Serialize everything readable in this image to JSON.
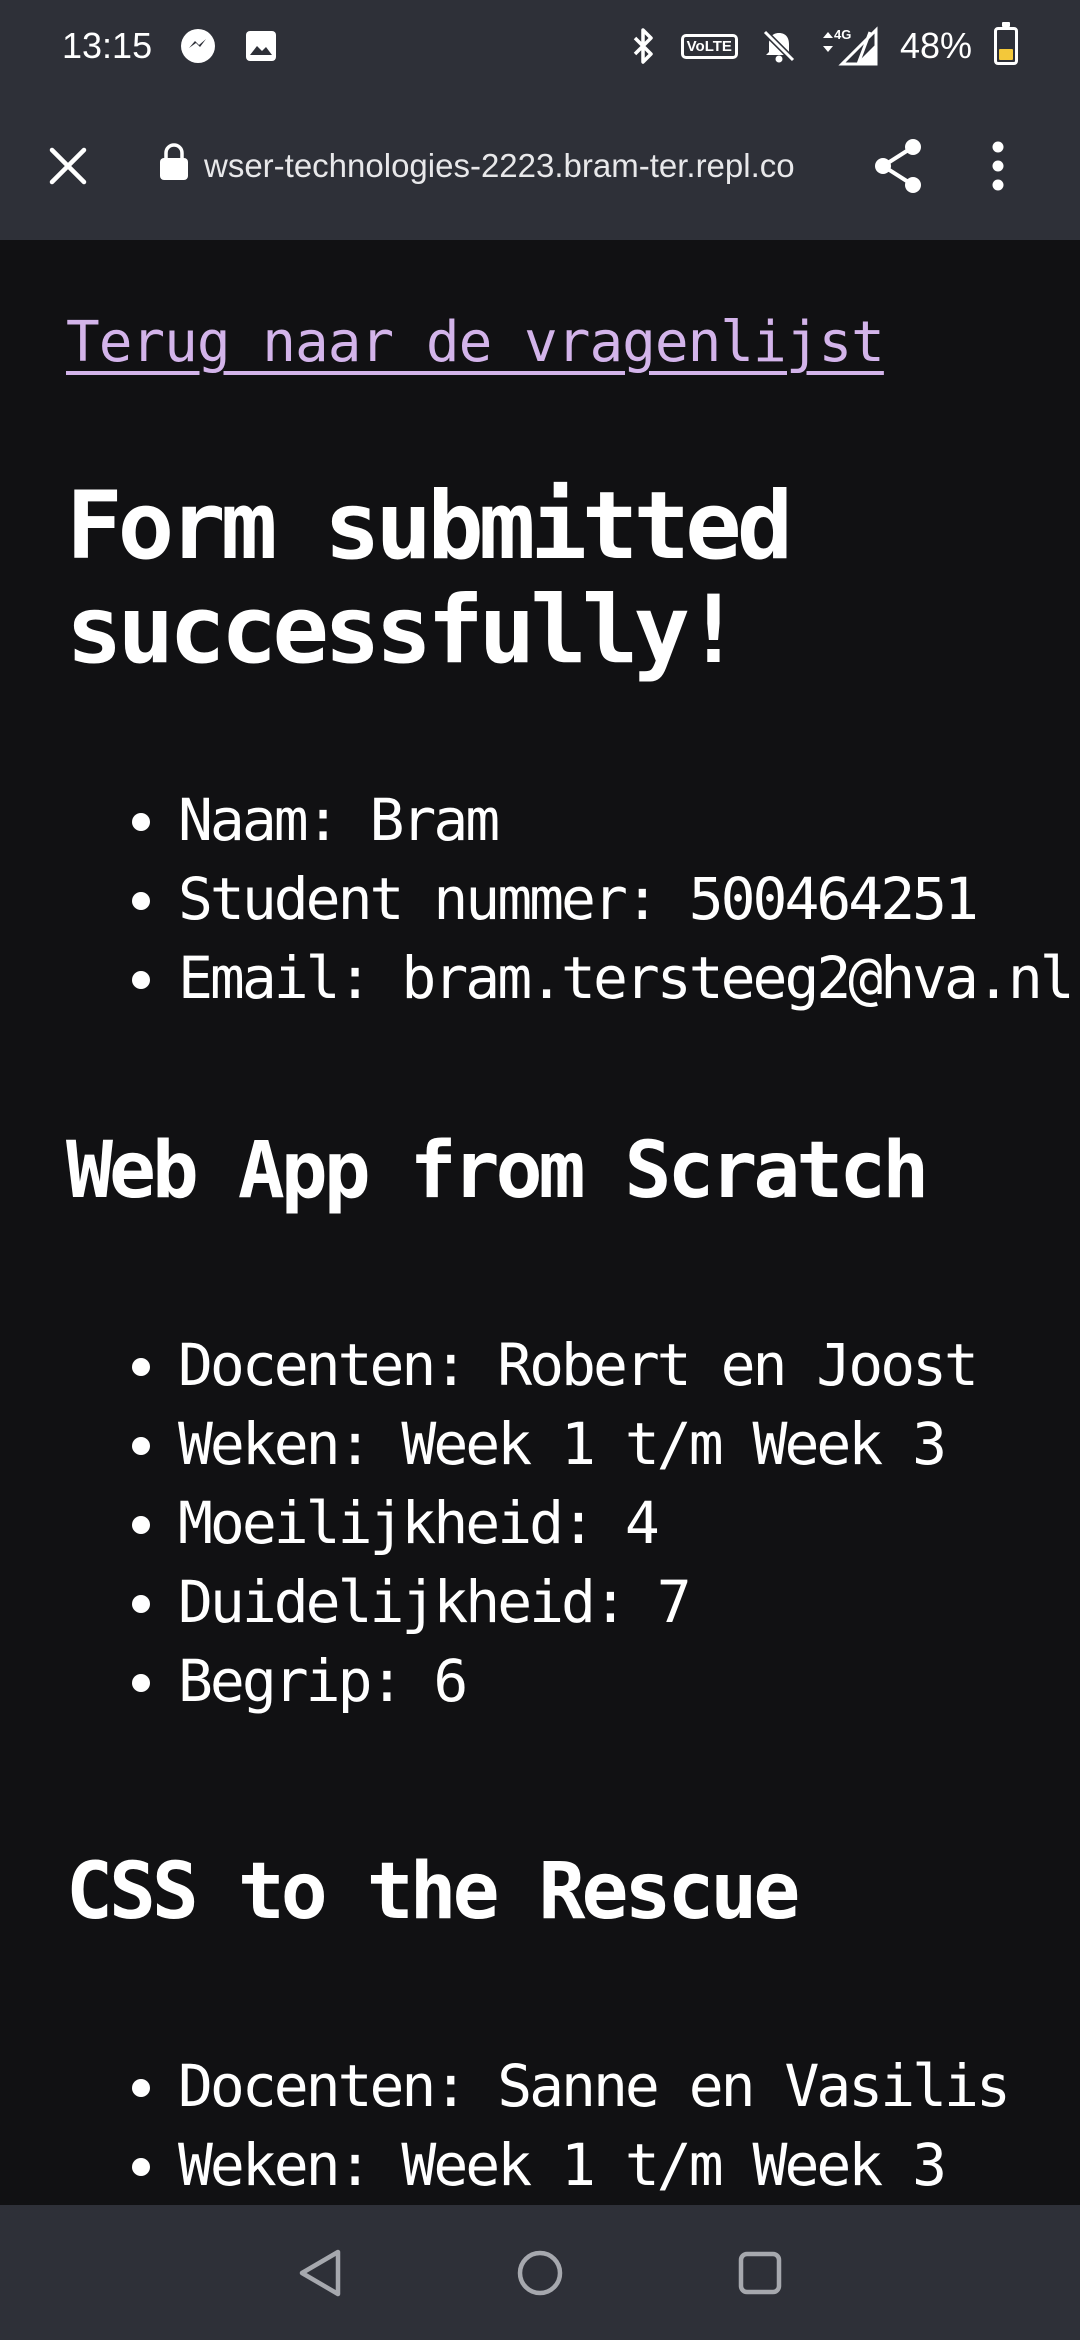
{
  "status_bar": {
    "time": "13:15",
    "battery_percent": "48%",
    "network": "4G",
    "volte": "VoLTE",
    "battery_level": 0.48
  },
  "browser": {
    "url": "wser-technologies-2223.bram-ter.repl.co"
  },
  "page": {
    "back_link": "Terug naar de vragenlijst",
    "title": "Form submitted successfully!",
    "user_info": [
      "Naam: Bram",
      "Student nummer: 500464251",
      "Email: bram.tersteeg2@hva.nl"
    ],
    "sections": [
      {
        "title": "Web App from Scratch",
        "items": [
          "Docenten: Robert en Joost",
          "Weken: Week 1 t/m Week 3",
          "Moeilijkheid: 4",
          "Duidelijkheid: 7",
          "Begrip: 6"
        ]
      },
      {
        "title": "CSS to the Rescue",
        "items": [
          "Docenten: Sanne en Vasilis",
          "Weken: Week 1 t/m Week 3"
        ]
      }
    ]
  },
  "colors": {
    "chrome": "#2e3038",
    "background": "#111113",
    "link": "#d3b4ea",
    "text": "#ffffff"
  }
}
